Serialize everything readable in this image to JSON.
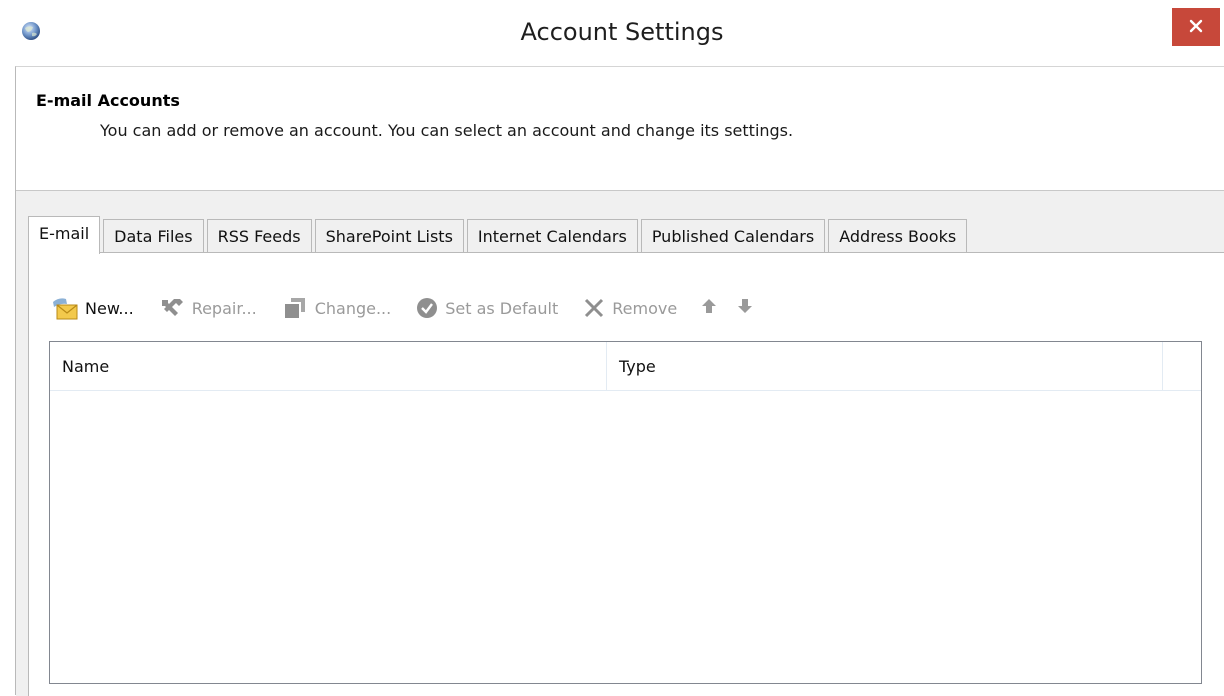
{
  "window": {
    "title": "Account Settings",
    "close_icon": "close-icon"
  },
  "header": {
    "title": "E-mail Accounts",
    "description": "You can add or remove an account. You can select an account and change its settings."
  },
  "tabs": [
    {
      "label": "E-mail",
      "active": true
    },
    {
      "label": "Data Files",
      "active": false
    },
    {
      "label": "RSS Feeds",
      "active": false
    },
    {
      "label": "SharePoint Lists",
      "active": false
    },
    {
      "label": "Internet Calendars",
      "active": false
    },
    {
      "label": "Published Calendars",
      "active": false
    },
    {
      "label": "Address Books",
      "active": false
    }
  ],
  "toolbar": {
    "new_label": "New...",
    "repair_label": "Repair...",
    "change_label": "Change...",
    "set_default_label": "Set as Default",
    "remove_label": "Remove"
  },
  "list": {
    "columns": [
      "Name",
      "Type"
    ],
    "rows": []
  },
  "colors": {
    "close_button": "#c7483a",
    "disabled_text": "#9a9a9a",
    "content_background": "#f0f0f0"
  }
}
